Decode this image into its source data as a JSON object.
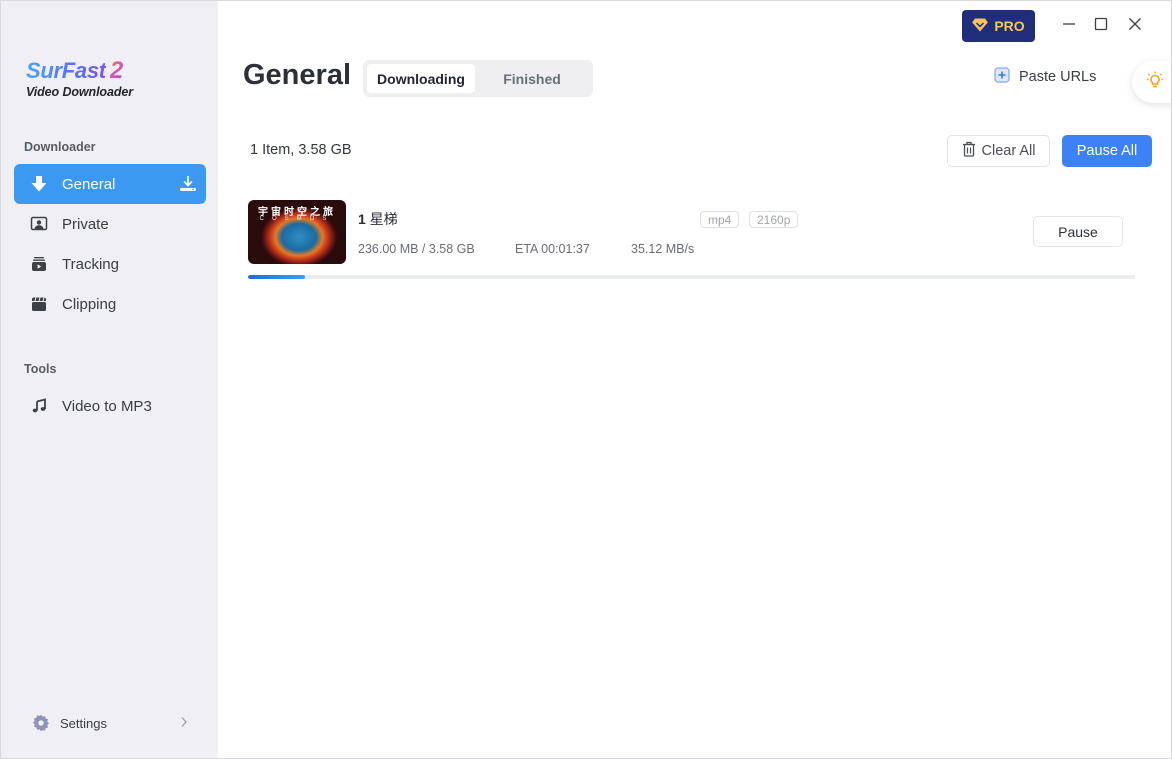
{
  "app": {
    "logo_title": "SurFast",
    "logo_version": "2",
    "logo_subtitle": "Video Downloader"
  },
  "sidebar": {
    "sections": [
      {
        "label": "Downloader",
        "items": [
          {
            "label": "General",
            "icon": "download-arrow-icon",
            "active": true
          },
          {
            "label": "Private",
            "icon": "private-user-icon",
            "active": false
          },
          {
            "label": "Tracking",
            "icon": "tracking-video-icon",
            "active": false
          },
          {
            "label": "Clipping",
            "icon": "clapperboard-icon",
            "active": false
          }
        ]
      },
      {
        "label": "Tools",
        "items": [
          {
            "label": "Video to MP3",
            "icon": "music-note-icon",
            "active": false
          }
        ]
      }
    ],
    "settings_label": "Settings"
  },
  "header": {
    "page_title": "General",
    "tabs": [
      {
        "label": "Downloading",
        "active": true
      },
      {
        "label": "Finished",
        "active": false
      }
    ],
    "pro_label": "PRO",
    "paste_urls_label": "Paste URLs"
  },
  "toolbar": {
    "summary": "1 Item, 3.58 GB",
    "clear_all_label": "Clear All",
    "pause_all_label": "Pause All"
  },
  "downloads": [
    {
      "index": "1",
      "title": "星梯",
      "thumb_text_cn": "宇宙时空之旅",
      "thumb_text_en": "COSMOS",
      "format": "mp4",
      "resolution": "2160p",
      "size_progress": "236.00 MB / 3.58 GB",
      "eta": "ETA 00:01:37",
      "speed": "35.12 MB/s",
      "progress_percent": 6.4,
      "action_label": "Pause"
    }
  ],
  "colors": {
    "accent": "#3b99f1",
    "primary_button": "#3c82f6",
    "pro_bg": "#1f2d7a",
    "pro_fg": "#f7c55e"
  }
}
